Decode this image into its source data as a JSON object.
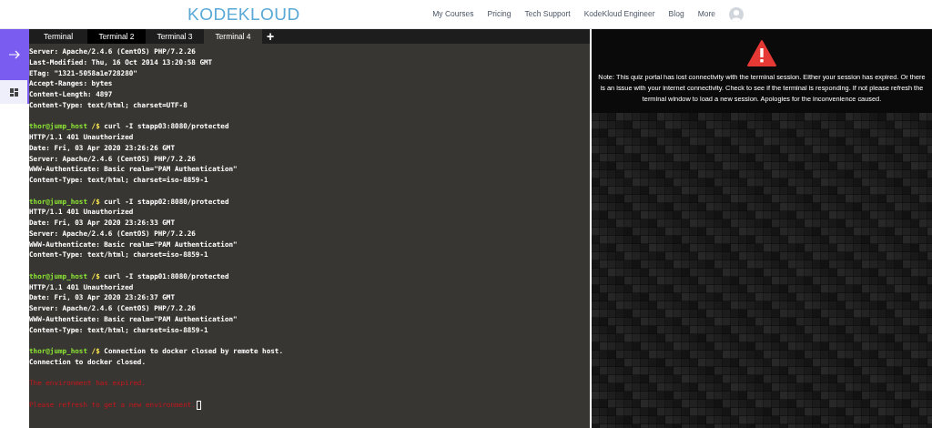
{
  "header": {
    "logo": "KODEKLOUD",
    "nav": [
      "My Courses",
      "Pricing",
      "Tech Support",
      "KodeKloud Engineer",
      "Blog",
      "More"
    ]
  },
  "sidebar": {
    "items": [
      {
        "kind": "arrow",
        "selected": false
      },
      {
        "kind": "grid",
        "selected": true
      }
    ]
  },
  "terminal": {
    "tabs": [
      {
        "label": "Terminal",
        "selected": false,
        "hovered": false
      },
      {
        "label": "Terminal 2",
        "selected": false,
        "hovered": true
      },
      {
        "label": "Terminal 3",
        "selected": false,
        "hovered": false
      },
      {
        "label": "Terminal 4",
        "selected": true,
        "hovered": false
      }
    ],
    "add_tab": "+",
    "lines": [
      {
        "kind": "output",
        "text": "Server: Apache/2.4.6 (CentOS) PHP/7.2.26"
      },
      {
        "kind": "output",
        "text": "Last-Modified: Thu, 16 Oct 2014 13:20:58 GMT"
      },
      {
        "kind": "output",
        "text": "ETag: \"1321-5058a1e728280\""
      },
      {
        "kind": "output",
        "text": "Accept-Ranges: bytes"
      },
      {
        "kind": "output",
        "text": "Content-Length: 4897"
      },
      {
        "kind": "output",
        "text": "Content-Type: text/html; charset=UTF-8"
      },
      {
        "kind": "blank"
      },
      {
        "kind": "prompt",
        "user": "thor@jump_host",
        "path": "/$",
        "command": "curl -I stapp03:8080/protected"
      },
      {
        "kind": "output",
        "text": "HTTP/1.1 401 Unauthorized"
      },
      {
        "kind": "output",
        "text": "Date: Fri, 03 Apr 2020 23:26:26 GMT"
      },
      {
        "kind": "output",
        "text": "Server: Apache/2.4.6 (CentOS) PHP/7.2.26"
      },
      {
        "kind": "output",
        "text": "WWW-Authenticate: Basic realm=\"PAM Authentication\""
      },
      {
        "kind": "output",
        "text": "Content-Type: text/html; charset=iso-8859-1"
      },
      {
        "kind": "blank"
      },
      {
        "kind": "prompt",
        "user": "thor@jump_host",
        "path": "/$",
        "command": "curl -I stapp02:8080/protected"
      },
      {
        "kind": "output",
        "text": "HTTP/1.1 401 Unauthorized"
      },
      {
        "kind": "output",
        "text": "Date: Fri, 03 Apr 2020 23:26:33 GMT"
      },
      {
        "kind": "output",
        "text": "Server: Apache/2.4.6 (CentOS) PHP/7.2.26"
      },
      {
        "kind": "output",
        "text": "WWW-Authenticate: Basic realm=\"PAM Authentication\""
      },
      {
        "kind": "output",
        "text": "Content-Type: text/html; charset=iso-8859-1"
      },
      {
        "kind": "blank"
      },
      {
        "kind": "prompt",
        "user": "thor@jump_host",
        "path": "/$",
        "command": "curl -I stapp01:8080/protected"
      },
      {
        "kind": "output",
        "text": "HTTP/1.1 401 Unauthorized"
      },
      {
        "kind": "output",
        "text": "Date: Fri, 03 Apr 2020 23:26:37 GMT"
      },
      {
        "kind": "output",
        "text": "Server: Apache/2.4.6 (CentOS) PHP/7.2.26"
      },
      {
        "kind": "output",
        "text": "WWW-Authenticate: Basic realm=\"PAM Authentication\""
      },
      {
        "kind": "output",
        "text": "Content-Type: text/html; charset=iso-8859-1"
      },
      {
        "kind": "blank"
      },
      {
        "kind": "prompt",
        "user": "thor@jump_host",
        "path": "/$",
        "command": "Connection to docker closed by remote host."
      },
      {
        "kind": "output",
        "text": "Connection to docker closed."
      },
      {
        "kind": "blank"
      },
      {
        "kind": "error",
        "text": "The environment has expired.",
        "cursor": false
      },
      {
        "kind": "blank"
      },
      {
        "kind": "error",
        "text": "Please refresh to get a new environment.",
        "cursor": true
      }
    ]
  },
  "notice": {
    "text": "Note: This quiz portal has lost connectivity with the terminal session. Either your session has expired. Or there is an issue with your internet connectivity. Check to see if the terminal is responding. If not please refresh the terminal window to load a new session. Apologies for the inconvenience caused."
  }
}
